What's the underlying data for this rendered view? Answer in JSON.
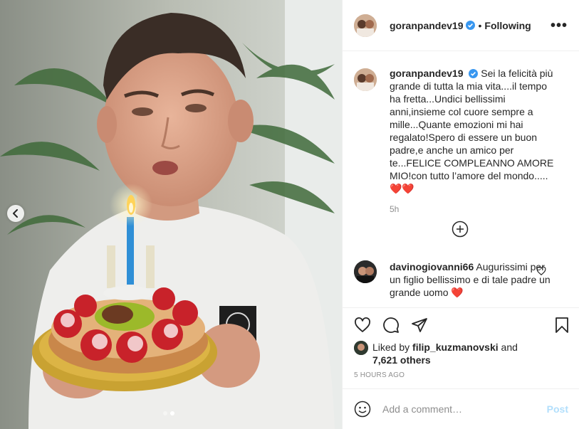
{
  "media": {
    "carousel_dots": 2,
    "active_dot": 1
  },
  "header": {
    "username": "goranpandev19",
    "separator": "•",
    "follow_status": "Following",
    "more_glyph": "•••"
  },
  "caption": {
    "username": "goranpandev19",
    "text": "Sei la felicità più grande di tutta la mia vita....il tempo ha fretta...Undici bellissimi anni,insieme col cuore sempre a mille...Quante emozioni mi hai regalato!Spero di essere un buon padre,e anche un amico per te...FELICE COMPLEANNO AMORE MIO!con tutto l’amore del mondo.....",
    "emoji": "❤️❤️",
    "time": "5h"
  },
  "comments": [
    {
      "username": "davinogiovanni66",
      "text": "Augurissimi per un figlio bellissimo e di tale padre un grande uomo",
      "emoji": "❤️"
    }
  ],
  "likes": {
    "prefix": "Liked by",
    "user": "filip_kuzmanovski",
    "and": "and",
    "others": "7,621 others"
  },
  "post_time": "5 HOURS AGO",
  "add_comment": {
    "placeholder": "Add a comment…",
    "post_label": "Post"
  },
  "icons": {
    "like": "heart-icon",
    "comment": "comment-icon",
    "share": "share-icon",
    "save": "bookmark-icon",
    "emoji": "emoji-icon",
    "load_more": "plus-circle-icon",
    "prev": "chevron-left-icon"
  },
  "colors": {
    "verified": "#3897f0",
    "heart": "#e0132b",
    "post_disabled": "#b2dffc",
    "muted": "#8e8e8e"
  }
}
